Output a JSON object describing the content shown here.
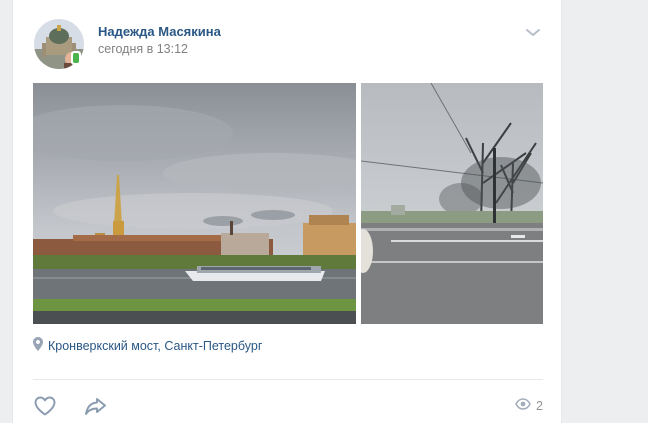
{
  "post": {
    "author": "Надежда Масякина",
    "time": "сегодня в 13:12",
    "location": "Кронверкский мост, Санкт-Петербург",
    "views": "2"
  },
  "icons": {
    "avatar": "avatar",
    "online": "mobile-online-icon",
    "menu": "chevron-down-icon",
    "location": "location-pin-icon",
    "like": "heart-icon",
    "share": "share-arrow-icon",
    "views": "eye-icon"
  },
  "colors": {
    "link": "#2a5885",
    "muted": "#828282",
    "online": "#4bb34b",
    "icon": "#8a9bb0"
  }
}
